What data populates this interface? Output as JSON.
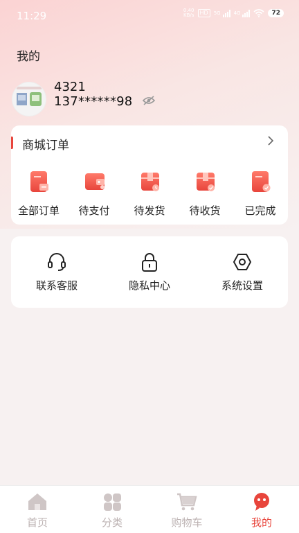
{
  "status_bar": {
    "time": "11:29",
    "net_speed_value": "0.40",
    "net_speed_unit": "KB/s",
    "hd_badge": "HD",
    "gen1": "5G",
    "gen2": "4G",
    "battery": "72"
  },
  "page_title": "我的",
  "profile": {
    "username": "4321",
    "phone": "137******98"
  },
  "orders": {
    "title": "商城订单",
    "items": [
      {
        "label": "全部订单",
        "icon": "all-orders-icon"
      },
      {
        "label": "待支付",
        "icon": "wallet-icon"
      },
      {
        "label": "待发货",
        "icon": "box-icon"
      },
      {
        "label": "待收货",
        "icon": "delivery-box-icon"
      },
      {
        "label": "已完成",
        "icon": "completed-icon"
      }
    ]
  },
  "services": [
    {
      "label": "联系客服",
      "icon": "headset-icon"
    },
    {
      "label": "隐私中心",
      "icon": "lock-icon"
    },
    {
      "label": "系统设置",
      "icon": "settings-icon"
    }
  ],
  "tabs": [
    {
      "label": "首页",
      "icon": "home-icon",
      "active": false
    },
    {
      "label": "分类",
      "icon": "category-icon",
      "active": false
    },
    {
      "label": "购物车",
      "icon": "cart-icon",
      "active": false
    },
    {
      "label": "我的",
      "icon": "profile-icon",
      "active": true
    }
  ],
  "colors": {
    "accent": "#e8453c",
    "inactive_tab": "#bdb3b3",
    "header_gradient_start": "#fbd3d3"
  }
}
